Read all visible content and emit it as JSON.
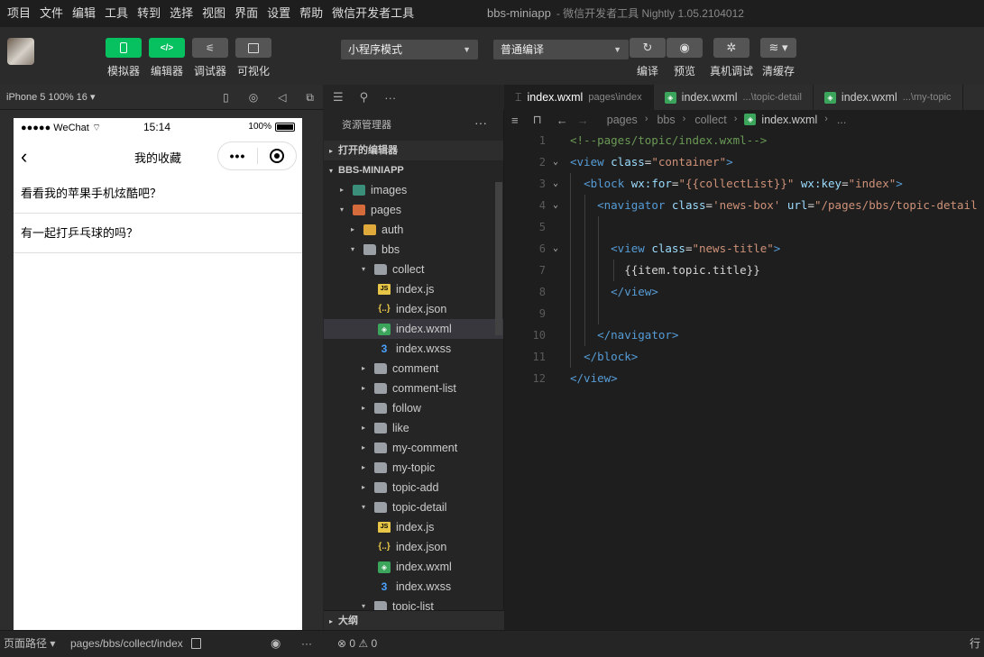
{
  "menubar": {
    "items": [
      "项目",
      "文件",
      "编辑",
      "工具",
      "转到",
      "选择",
      "视图",
      "界面",
      "设置",
      "帮助",
      "微信开发者工具"
    ],
    "title": "bbs-miniapp",
    "subtitle": "- 微信开发者工具 Nightly 1.05.2104012"
  },
  "toolbar": {
    "simulator": "模拟器",
    "editor": "编辑器",
    "debugger": "调试器",
    "visual": "可视化",
    "mode_select": "小程序模式",
    "compile_select": "普通编译",
    "compile": "编译",
    "preview": "预览",
    "remote_debug": "真机调试",
    "clear_cache": "清缓存"
  },
  "simulator": {
    "device": "iPhone 5 100% 16 ▾",
    "carrier": "●●●●● WeChat",
    "time": "15:14",
    "battery": "100%",
    "nav_title": "我的收藏",
    "capsule_dots": "•••",
    "items": [
      "看看我的苹果手机炫酷吧？",
      "有一起打乒乓球的吗？"
    ]
  },
  "explorer": {
    "title": "资源管理器",
    "more": "···",
    "open_editors": "打开的编辑器",
    "project": "BBS-MINIAPP",
    "outline": "大纲",
    "tree": [
      {
        "name": "images",
        "level": 1,
        "kind": "folder-img",
        "arrow": "▸"
      },
      {
        "name": "pages",
        "level": 1,
        "kind": "folder-pages",
        "arrow": "▾"
      },
      {
        "name": "auth",
        "level": 2,
        "kind": "folder-auth",
        "arrow": "▸"
      },
      {
        "name": "bbs",
        "level": 2,
        "kind": "folder",
        "arrow": "▾"
      },
      {
        "name": "collect",
        "level": 3,
        "kind": "folder",
        "arrow": "▾"
      },
      {
        "name": "index.js",
        "level": 4,
        "kind": "js"
      },
      {
        "name": "index.json",
        "level": 4,
        "kind": "json"
      },
      {
        "name": "index.wxml",
        "level": 4,
        "kind": "wxml",
        "selected": true
      },
      {
        "name": "index.wxss",
        "level": 4,
        "kind": "wxss"
      },
      {
        "name": "comment",
        "level": 3,
        "kind": "folder",
        "arrow": "▸"
      },
      {
        "name": "comment-list",
        "level": 3,
        "kind": "folder",
        "arrow": "▸"
      },
      {
        "name": "follow",
        "level": 3,
        "kind": "folder",
        "arrow": "▸"
      },
      {
        "name": "like",
        "level": 3,
        "kind": "folder",
        "arrow": "▸"
      },
      {
        "name": "my-comment",
        "level": 3,
        "kind": "folder",
        "arrow": "▸"
      },
      {
        "name": "my-topic",
        "level": 3,
        "kind": "folder",
        "arrow": "▸"
      },
      {
        "name": "topic-add",
        "level": 3,
        "kind": "folder",
        "arrow": "▸"
      },
      {
        "name": "topic-detail",
        "level": 3,
        "kind": "folder",
        "arrow": "▾"
      },
      {
        "name": "index.js",
        "level": 4,
        "kind": "js"
      },
      {
        "name": "index.json",
        "level": 4,
        "kind": "json"
      },
      {
        "name": "index.wxml",
        "level": 4,
        "kind": "wxml"
      },
      {
        "name": "index.wxss",
        "level": 4,
        "kind": "wxss"
      },
      {
        "name": "topic-list",
        "level": 3,
        "kind": "folder",
        "arrow": "▾"
      }
    ]
  },
  "editor": {
    "tabs": [
      {
        "name": "index.wxml",
        "path": "pages\\index",
        "active": true
      },
      {
        "name": "index.wxml",
        "path": "...\\topic-detail"
      },
      {
        "name": "index.wxml",
        "path": "...\\my-topic"
      }
    ],
    "breadcrumb": [
      "pages",
      "bbs",
      "collect",
      "index.wxml",
      "..."
    ],
    "lines": [
      {
        "n": "1",
        "fold": "",
        "parts": [
          [
            "c-com",
            "<!--pages/topic/index.wxml-->"
          ]
        ]
      },
      {
        "n": "2",
        "fold": "⌄",
        "parts": [
          [
            "c-tag",
            "<view "
          ],
          [
            "c-attr",
            "class"
          ],
          [
            "c-eq",
            "="
          ],
          [
            "c-str",
            "\"container\""
          ],
          [
            "c-tag",
            ">"
          ]
        ]
      },
      {
        "n": "3",
        "fold": "⌄",
        "parts": [
          [
            "c-txt",
            "  "
          ],
          [
            "c-tag",
            "<block "
          ],
          [
            "c-attr",
            "wx:for"
          ],
          [
            "c-eq",
            "="
          ],
          [
            "c-str",
            "\"{{collectList}}\""
          ],
          [
            "c-txt",
            " "
          ],
          [
            "c-attr",
            "wx:key"
          ],
          [
            "c-eq",
            "="
          ],
          [
            "c-str",
            "\"index\""
          ],
          [
            "c-tag",
            ">"
          ]
        ]
      },
      {
        "n": "4",
        "fold": "⌄",
        "parts": [
          [
            "c-txt",
            "    "
          ],
          [
            "c-tag",
            "<navigator "
          ],
          [
            "c-attr",
            "class"
          ],
          [
            "c-eq",
            "="
          ],
          [
            "c-str",
            "'news-box'"
          ],
          [
            "c-txt",
            " "
          ],
          [
            "c-attr",
            "url"
          ],
          [
            "c-eq",
            "="
          ],
          [
            "c-str",
            "\"/pages/bbs/topic-detail"
          ]
        ]
      },
      {
        "n": "5",
        "fold": "",
        "parts": []
      },
      {
        "n": "6",
        "fold": "⌄",
        "parts": [
          [
            "c-txt",
            "      "
          ],
          [
            "c-tag",
            "<view "
          ],
          [
            "c-attr",
            "class"
          ],
          [
            "c-eq",
            "="
          ],
          [
            "c-str",
            "\"news-title\""
          ],
          [
            "c-tag",
            ">"
          ]
        ]
      },
      {
        "n": "7",
        "fold": "",
        "parts": [
          [
            "c-txt",
            "        {{item.topic.title}}"
          ]
        ]
      },
      {
        "n": "8",
        "fold": "",
        "parts": [
          [
            "c-txt",
            "      "
          ],
          [
            "c-tag",
            "</view>"
          ]
        ]
      },
      {
        "n": "9",
        "fold": "",
        "parts": []
      },
      {
        "n": "10",
        "fold": "",
        "parts": [
          [
            "c-txt",
            "    "
          ],
          [
            "c-tag",
            "</navigator>"
          ]
        ]
      },
      {
        "n": "11",
        "fold": "",
        "parts": [
          [
            "c-txt",
            "  "
          ],
          [
            "c-tag",
            "</block>"
          ]
        ]
      },
      {
        "n": "12",
        "fold": "",
        "parts": [
          [
            "c-tag",
            "</view>"
          ]
        ]
      }
    ]
  },
  "statusbar": {
    "page_path_label": "页面路径 ▾",
    "page_path": "pages/bbs/collect/index",
    "errors": "⊗ 0 ⚠ 0",
    "right": "行"
  },
  "colors": {
    "accent_green": "#07c160",
    "editor_bg": "#1e1e1e",
    "sidebar_bg": "#252526"
  }
}
